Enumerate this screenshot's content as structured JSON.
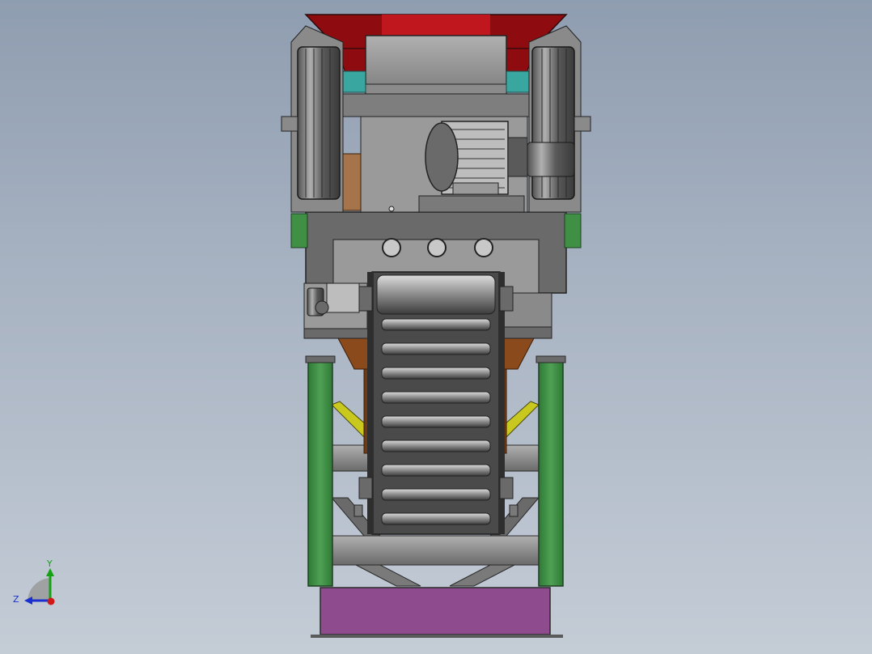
{
  "view": {
    "orientation_triad": {
      "axes": [
        {
          "name": "Y",
          "color": "#16a016"
        },
        {
          "name": "Z",
          "color": "#1a2fd0"
        }
      ],
      "origin_color": "#d01818"
    }
  },
  "model": {
    "components": [
      "feed-hopper",
      "flywheel-left",
      "flywheel-right",
      "drive-motor",
      "crusher-body",
      "main-frame",
      "belt-conveyor",
      "conveyor-drive",
      "support-legs",
      "discharge-bin"
    ],
    "colors": {
      "hopper": "#c0161e",
      "hopper_dark": "#8e0c10",
      "steel": "#8c8c8c",
      "steel_dark": "#3a3a3a",
      "leg": "#3f8f45",
      "rust": "#8a4a1c",
      "brace": "#c8c81e",
      "bin": "#8e4b8e",
      "teal": "#3aa6a0"
    }
  }
}
